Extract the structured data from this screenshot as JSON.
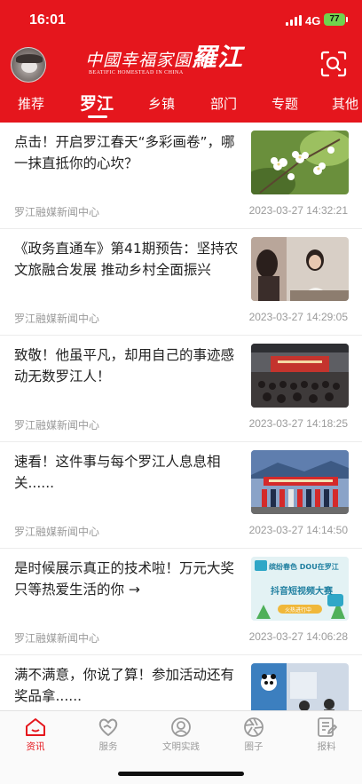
{
  "status_bar": {
    "time": "16:01",
    "network": "4G",
    "battery": "77"
  },
  "header": {
    "brand_main": "中國幸福家園",
    "brand_accent": "羅江",
    "brand_sub": "BEATIFIC HOMESTEAD IN CHINA"
  },
  "tabs": [
    {
      "label": "推荐"
    },
    {
      "label": "罗江"
    },
    {
      "label": "乡镇"
    },
    {
      "label": "部门"
    },
    {
      "label": "专题"
    },
    {
      "label": "其他"
    }
  ],
  "articles": [
    {
      "title": "点击！开启罗江春天“多彩画卷”，哪一抹直抵你的心坎？",
      "source": "罗江融媒新闻中心",
      "time": "2023-03-27 14:32:21"
    },
    {
      "title": "《政务直通车》第41期预告：坚持农文旅融合发展 推动乡村全面振兴",
      "source": "罗江融媒新闻中心",
      "time": "2023-03-27 14:29:05"
    },
    {
      "title": "致敬！他虽平凡，却用自己的事迹感动无数罗江人！",
      "source": "罗江融媒新闻中心",
      "time": "2023-03-27 14:18:25"
    },
    {
      "title": "速看！这件事与每个罗江人息息相关......",
      "source": "罗江融媒新闻中心",
      "time": "2023-03-27 14:14:50"
    },
    {
      "title": "是时候展示真正的技术啦！万元大奖只等热爱生活的你 →",
      "source": "罗江融媒新闻中心",
      "time": "2023-03-27 14:06:28",
      "thumb_text": {
        "line1": "缤纷春色 DOU在罗江",
        "line2": "抖音短视频大赛",
        "line3": "火热进行中"
      }
    },
    {
      "title": "满不满意，你说了算！参加活动还有奖品拿......",
      "source": "",
      "time": ""
    }
  ],
  "bottom_nav": [
    {
      "label": "资讯",
      "icon": "home-icon"
    },
    {
      "label": "服务",
      "icon": "heart-hands-icon"
    },
    {
      "label": "文明实践",
      "icon": "civilization-icon"
    },
    {
      "label": "圈子",
      "icon": "circle-aperture-icon"
    },
    {
      "label": "报料",
      "icon": "report-icon"
    }
  ],
  "colors": {
    "brand_red": "#e5161d",
    "text": "#222222",
    "muted": "#9a9a9a"
  }
}
